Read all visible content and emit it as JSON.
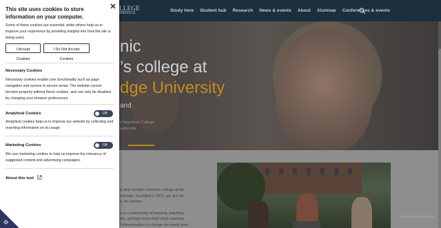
{
  "site": {
    "logo_line1": "LLEGE",
    "logo_line2": "BRIDGE",
    "nav": [
      "Study here",
      "Student hub",
      "Research",
      "News & events",
      "About",
      "Alumnae",
      "Conferences & events"
    ],
    "hero": {
      "title_line1": "nic",
      "title_line2": "’s college at",
      "title_line3": "dge University",
      "subtitle": "and",
      "caption_line1": "d Newnham College",
      "caption_line2": "tudent life"
    },
    "body_lines": [
      "ly and sociable women’s college at the",
      "mbridge. Founded in 1871, we are the",
      "n, for women.",
      "e is a community of learning, teaching",
      "am, perhaps more than most, learning",
      "t determination to change the world (and,"
    ],
    "feedback_label": "Feedback and report"
  },
  "cookie_panel": {
    "title": "This site uses cookies to store information on your computer.",
    "intro": "Some of these cookies are essential, while others help us to improve your experience by providing insights into how the site is being used.",
    "accept_label": "I Accept Cookies",
    "reject_label": "I Do Not Accept Cookies",
    "sections": {
      "necessary": {
        "title": "Necessary Cookies",
        "text": "Necessary cookies enable core functionality such as page navigation and access to secure areas. The website cannot function properly without these cookies, and can only be disabled by changing your browser preferences."
      },
      "analytical": {
        "title": "Analytical Cookies",
        "text": "Analytical cookies help us to improve our website by collecting and reporting information on its usage.",
        "toggle_label": "Off"
      },
      "marketing": {
        "title": "Marketing Cookies",
        "text": "We use marketing cookies to help us improve the relevancy of suggested content and advertising campaigns.",
        "toggle_label": "Off"
      }
    },
    "about_label": "About this tool",
    "close_icon": "close-icon",
    "colors": {
      "toggle": "#3c4359",
      "corner": "#2f3560",
      "accent": "#c58a1f"
    }
  }
}
